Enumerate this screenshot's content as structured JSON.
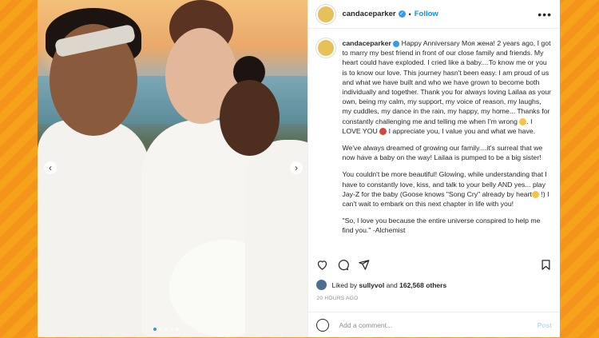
{
  "post": {
    "username": "candaceparker",
    "follow_label": "Follow",
    "more_icon": "more-dots-icon"
  },
  "caption": {
    "p1": "Happy Anniversary Моя жена! 2 years ago, I got to marry my best friend in front of our close family and friends. My heart could have exploded. I cried like a baby....To know me or you is to know our love. This journey hasn't been easy. I am proud of us and what we have built and who we have grown to become both individually and together. Thank you for always loving Lailaa as your own, being my calm, my support, my voice of reason, my laughs, my cuddles, my dance in the rain, my happy, my home... Thanks for constantly challenging me and telling me when I'm wrong",
    "p1b": ". I LOVE YOU",
    "p1c": " I appreciate you, I value you and what we have.",
    "p2": "We've always dreamed of growing our family....it's surreal that we now have a baby on the way! Lailaa is pumped to be a big sister!",
    "p3": "You couldn't be more beautiful! Glowing, while understanding that I have to constantly love, kiss, and talk to your belly AND yes... play Jay-Z for the baby (Goose knows \"Song Cry\" already by heart",
    "p3b": " !) I can't wait to embark on this next chapter in life with you!",
    "p4": "\"So, I love you because the entire universe conspired to help me find you.\" -Alchemist"
  },
  "likes": {
    "prefix": "Liked by",
    "user": "sullyvol",
    "mid": "and",
    "count": "162,568 others"
  },
  "timestamp": "20 HOURS AGO",
  "comment": {
    "placeholder": "Add a comment...",
    "post_label": "Post"
  },
  "colors": {
    "link_blue": "#0095f6",
    "background_orange": "#f7a21b"
  }
}
